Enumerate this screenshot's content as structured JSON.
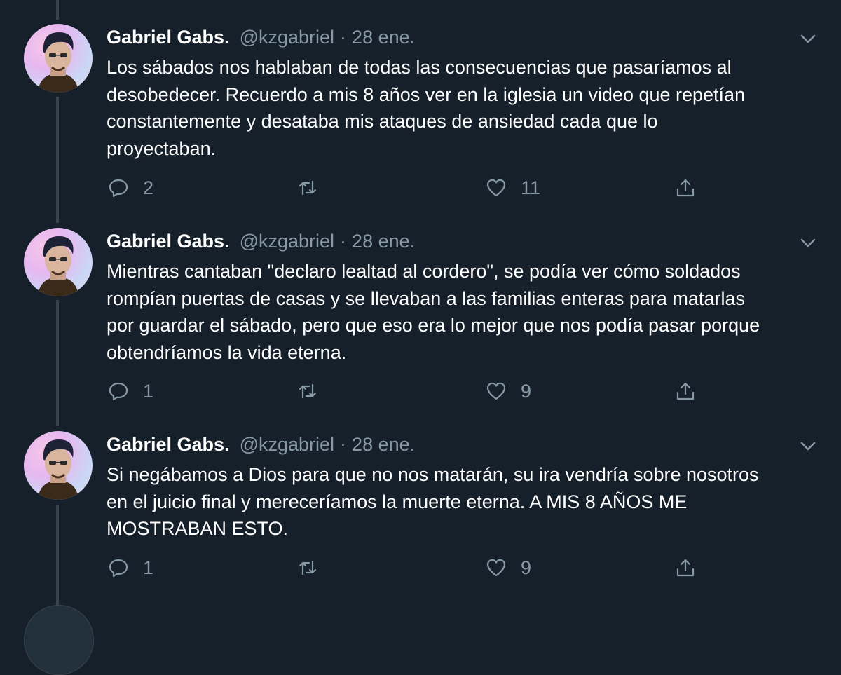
{
  "tweets": [
    {
      "name": "Gabriel Gabs.",
      "handle": "@kzgabriel",
      "separator": "·",
      "time": "28 ene.",
      "lines": [
        "Los sábados nos hablaban de todas las consecuencias que pasaríamos al",
        "desobedecer. Recuerdo a mis 8 años ver en la iglesia un video que repetían",
        "constantemente y desataba mis ataques de ansiedad cada que lo",
        "proyectaban."
      ],
      "replies": "2",
      "retweets": "",
      "likes": "11"
    },
    {
      "name": "Gabriel Gabs.",
      "handle": "@kzgabriel",
      "separator": "·",
      "time": "28 ene.",
      "lines": [
        "Mientras cantaban \"declaro lealtad al cordero\", se podía ver cómo soldados",
        "rompían puertas de casas y se llevaban a las familias enteras para matarlas",
        "por guardar el sábado, pero que eso era lo mejor que nos podía pasar porque",
        "obtendríamos la vida eterna."
      ],
      "replies": "1",
      "retweets": "",
      "likes": "9"
    },
    {
      "name": "Gabriel Gabs.",
      "handle": "@kzgabriel",
      "separator": "·",
      "time": "28 ene.",
      "lines": [
        "Si negábamos a Dios para que no nos matarán, su ira vendría sobre nosotros",
        "en el juicio final y mereceríamos la muerte eterna. A MIS 8 AÑOS ME",
        "MOSTRABAN ESTO."
      ],
      "replies": "1",
      "retweets": "",
      "likes": "9"
    }
  ],
  "icons": {
    "reply": "reply-icon",
    "retweet": "retweet-icon",
    "like": "heart-icon",
    "share": "share-icon",
    "more": "chevron-down-icon"
  },
  "colors": {
    "background": "#15202b",
    "text": "#ffffff",
    "muted": "#8899a6",
    "thread_line": "#38444d"
  }
}
